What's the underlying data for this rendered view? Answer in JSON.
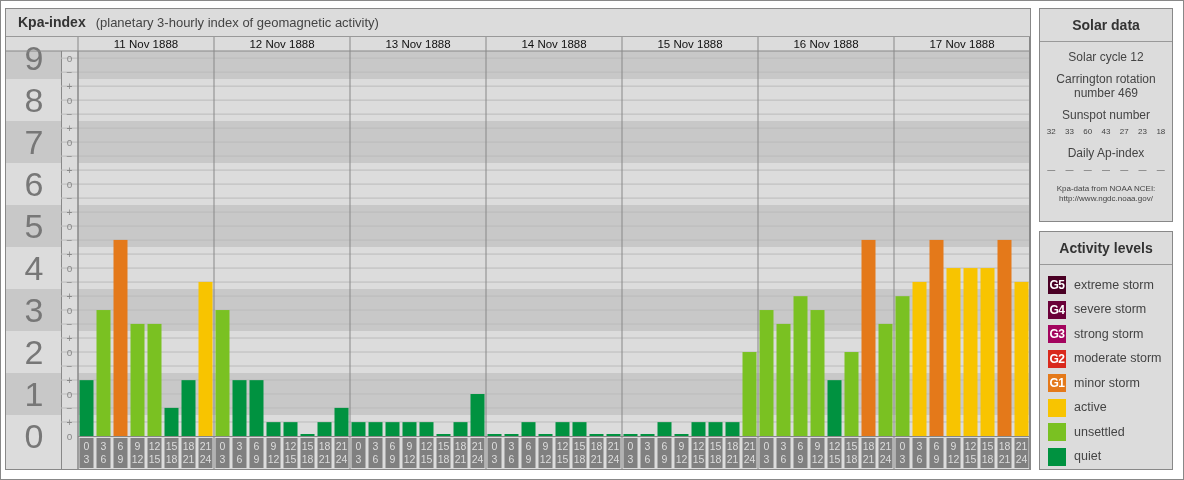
{
  "title": {
    "name": "Kpa-index",
    "subtitle": "(planetary 3-hourly index of geomagnetic activity)"
  },
  "days": [
    "11 Nov 1888",
    "12 Nov 1888",
    "13 Nov 1888",
    "14 Nov 1888",
    "15 Nov 1888",
    "16 Nov 1888",
    "17 Nov 1888"
  ],
  "y_axis": [
    {
      "label": "9",
      "marks": [
        "o",
        "−"
      ]
    },
    {
      "label": "8",
      "marks": [
        "+",
        "o",
        "−"
      ]
    },
    {
      "label": "7",
      "marks": [
        "+",
        "o",
        "−"
      ]
    },
    {
      "label": "6",
      "marks": [
        "+",
        "o",
        "−"
      ]
    },
    {
      "label": "5",
      "marks": [
        "+",
        "o",
        "−"
      ]
    },
    {
      "label": "4",
      "marks": [
        "+",
        "o",
        "−"
      ]
    },
    {
      "label": "3",
      "marks": [
        "+",
        "o",
        "−"
      ]
    },
    {
      "label": "2",
      "marks": [
        "+",
        "o",
        "−"
      ]
    },
    {
      "label": "1",
      "marks": [
        "+",
        "o",
        "−"
      ]
    },
    {
      "label": "0",
      "marks": [
        "+",
        "o"
      ]
    }
  ],
  "chart_data": {
    "type": "bar",
    "grid": true,
    "ylim": [
      0,
      9.17
    ],
    "yticks": [
      0,
      1,
      2,
      3,
      4,
      5,
      6,
      7,
      8,
      9
    ],
    "categories": [
      "0 3",
      "3 6",
      "6 9",
      "9 12",
      "12 15",
      "15 18",
      "18 21",
      "21 24",
      "0 3",
      "3 6",
      "6 9",
      "9 12",
      "12 15",
      "15 18",
      "18 21",
      "21 24",
      "0 3",
      "3 6",
      "6 9",
      "9 12",
      "12 15",
      "15 18",
      "18 21",
      "21 24",
      "0 3",
      "3 6",
      "6 9",
      "9 12",
      "12 15",
      "15 18",
      "18 21",
      "21 24",
      "0 3",
      "3 6",
      "6 9",
      "9 12",
      "12 15",
      "15 18",
      "18 21",
      "21 24",
      "0 3",
      "3 6",
      "6 9",
      "9 12",
      "12 15",
      "15 18",
      "18 21",
      "21 24",
      "0 3",
      "3 6",
      "6 9",
      "9 12",
      "12 15",
      "15 18",
      "18 21",
      "21 24"
    ],
    "series": [
      {
        "values": [
          1.33,
          3,
          4.67,
          2.67,
          2.67,
          0.67,
          1.33,
          3.67,
          3,
          1.33,
          1.33,
          0.33,
          0.33,
          0,
          0.33,
          0.67,
          0.33,
          0.33,
          0.33,
          0.33,
          0.33,
          0,
          0.33,
          1,
          0,
          0,
          0.33,
          0,
          0.33,
          0.33,
          0,
          0,
          0,
          0,
          0.33,
          0,
          0.33,
          0.33,
          0.33,
          2,
          3,
          2.67,
          3.33,
          3,
          1.33,
          2,
          4.67,
          2.67,
          3.33,
          3.67,
          4.67,
          4,
          4,
          4,
          4.67,
          3.67
        ]
      }
    ]
  },
  "solar": {
    "title": "Solar data",
    "cycle": "Solar cycle 12",
    "rotation": "Carrington rotation number 469",
    "sunspot_title": "Sunspot number",
    "sunspots": [
      "32",
      "33",
      "60",
      "43",
      "27",
      "23",
      "18"
    ],
    "ap_title": "Daily Ap-index",
    "ap_values": [
      "—",
      "—",
      "—",
      "—",
      "—",
      "—",
      "—"
    ],
    "source": "Kpa-data from NOAA NCEI:",
    "source_url": "http://www.ngdc.noaa.gov/"
  },
  "legend": {
    "title": "Activity levels",
    "items": [
      {
        "badge": "G5",
        "label": "extreme storm",
        "color": "#4a0024"
      },
      {
        "badge": "G4",
        "label": "severe storm",
        "color": "#6a0038"
      },
      {
        "badge": "G3",
        "label": "strong storm",
        "color": "#a3045e"
      },
      {
        "badge": "G2",
        "label": "moderate storm",
        "color": "#d9291c"
      },
      {
        "badge": "G1",
        "label": "minor storm",
        "color": "#e4791a"
      },
      {
        "label": "active",
        "color": "#f8c400"
      },
      {
        "label": "unsettled",
        "color": "#7ac122"
      },
      {
        "label": "quiet",
        "color": "#009240"
      }
    ]
  }
}
